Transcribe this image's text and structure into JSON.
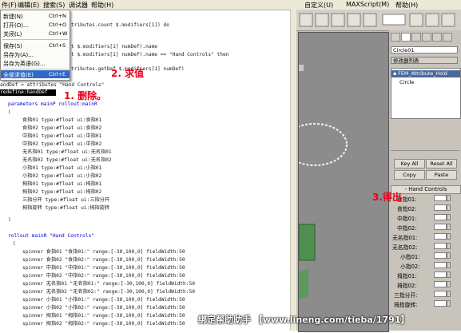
{
  "editor": {
    "menu": [
      "件(F)",
      "编辑(E)",
      "搜索(S)",
      "调试器",
      "帮助(H)"
    ],
    "file_menu": [
      {
        "label": "新建(N)",
        "shortcut": "Ctrl+N"
      },
      {
        "label": "打开(O)...",
        "shortcut": "Ctrl+O"
      },
      {
        "label": "关闭(L)",
        "shortcut": "Ctrl+W"
      },
      {
        "label": "保存(S)",
        "shortcut": "Ctrl+S"
      },
      {
        "label": "另存为(A)..."
      },
      {
        "label": "另存为英语(G)..."
      },
      {
        "label": "全部求值(E)",
        "shortcut": "Ctrl+E"
      }
    ],
    "code_lines": [
      "tributes.count $.modifiers[1]) do",
      "t $.modifiers[1] numDef).name",
      "t $.modifiers[1] numDef).name == \"Hand Controls\" then",
      "tributes.getDef $.modifiers[1] numDef)",
      "andDef = attributes \"Hand Controls\"",
      "redefine:handDef",
      "parameters mainP rollout:mainR",
      "(",
      "食指01 type:#float ui:食指01",
      "食指02 type:#float ui:食指02",
      "中指01 type:#float ui:中指01",
      "中指02 type:#float ui:中指02",
      "无名指01 type:#float ui:无名指01",
      "无名指02 type:#float ui:无名指02",
      "小指01 type:#float ui:小指01",
      "小指02 type:#float ui:小指02",
      "拇指01 type:#float ui:拇指01",
      "拇指02 type:#float ui:拇指02",
      "三指分开 type:#float ui:三指分开",
      "拇指旋转 type:#float ui:拇指旋转",
      ")",
      "rollout mainR \"Hand Controls\"",
      "(",
      "spinner 食指01 \"食指01:\" range:[-30,100,0] fieldWidth:50",
      "spinner 食指02 \"食指02:\" range:[-30,100,0] fieldWidth:50",
      "spinner 中指01 \"中指01:\" range:[-30,100,0] fieldWidth:50",
      "spinner 中指02 \"中指02:\" range:[-30,100,0] fieldWidth:50",
      "spinner 无名指01 \"无名指01:\" range:[-30,100,0] fieldWidth:50",
      "spinner 无名指02 \"无名指02:\" range:[-30,100,0] fieldWidth:50",
      "spinner 小指01 \"小指01:\" range:[-30,100,0] fieldWidth:50",
      "spinner 小指02 \"小指02:\" range:[-30,100,0] fieldWidth:50",
      "spinner 拇指01 \"拇指01:\" range:[-30,100,0] fieldWidth:50",
      "spinner 拇指02 \"拇指02:\" range:[-30,100,0] fieldWidth:50",
      "spinner 三指分开 \"三指分开:\" range:[-30,100,0] fieldWidth:50"
    ],
    "annotations": {
      "evaluate": "2. 求值",
      "delete": "1. 删除。",
      "result": "3.得出"
    }
  },
  "max": {
    "menu": [
      "自定义(U)",
      "MAXScript(M)",
      "帮助(H)"
    ],
    "object_name": "Circle01",
    "modifier_list_label": "修改器列表",
    "stack": [
      "FEM_Attribute_Hold",
      "Circle"
    ],
    "buttons": {
      "key_all": "Key All",
      "reset_all": "Reset All",
      "copy": "Copy",
      "paste": "Paste"
    },
    "rollout_title": "Hand Controls",
    "spinners": [
      {
        "label": "食指01:",
        "value": "0.0"
      },
      {
        "label": "食指02:",
        "value": "0.0"
      },
      {
        "label": "中指01:",
        "value": "0.0"
      },
      {
        "label": "中指02:",
        "value": "0.0"
      },
      {
        "label": "无名指01:",
        "value": "0.0"
      },
      {
        "label": "无名指02:",
        "value": "0.0"
      },
      {
        "label": "小指01:",
        "value": "0.0"
      },
      {
        "label": "小指02:",
        "value": "0.0"
      },
      {
        "label": "拇指01:",
        "value": "0.0"
      },
      {
        "label": "拇指02:",
        "value": "0.0"
      },
      {
        "label": "三指分开:",
        "value": "0.0"
      },
      {
        "label": "拇指旋转:",
        "value": "0.0"
      }
    ]
  },
  "watermark": "绑定帮助助手 【www.lineng.com/tieba/1791】"
}
